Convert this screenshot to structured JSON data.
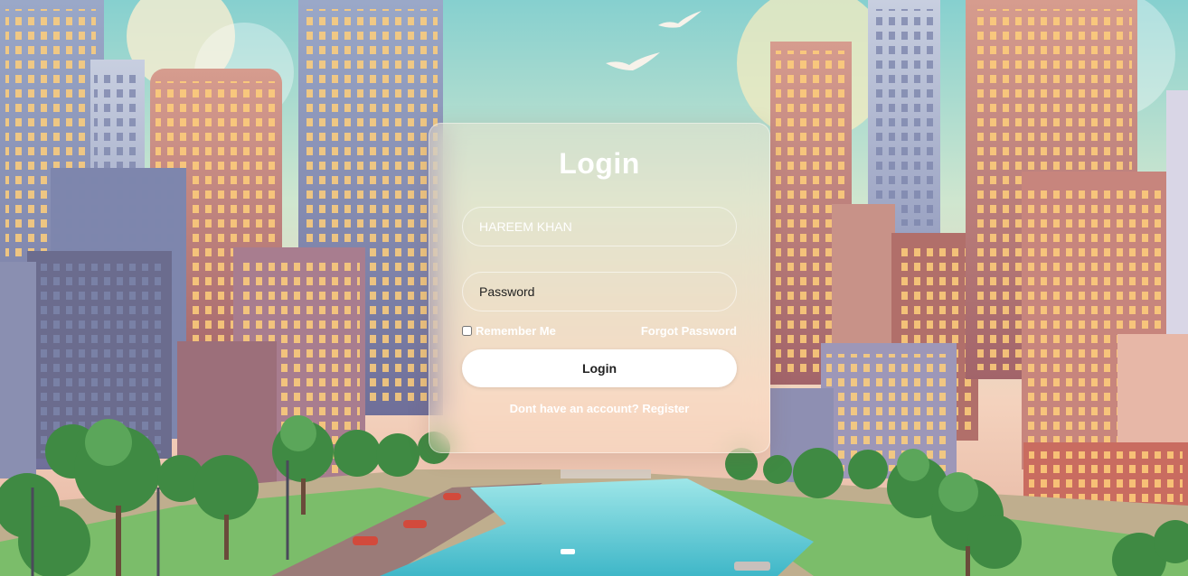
{
  "form": {
    "title": "Login",
    "username_value": "HAREEM KHAN",
    "password_placeholder": "Password",
    "remember_label": "Remember Me",
    "forgot_label": "Forgot Password",
    "submit_label": "Login",
    "register_prompt": "Dont have an account?",
    "register_label": "Register"
  },
  "colors": {
    "card_tint": "#ffe4cd",
    "button_bg": "#ffffff",
    "text_light": "#ffffff",
    "text_dark": "#222222"
  },
  "icons": {
    "background": "city-illustration"
  }
}
